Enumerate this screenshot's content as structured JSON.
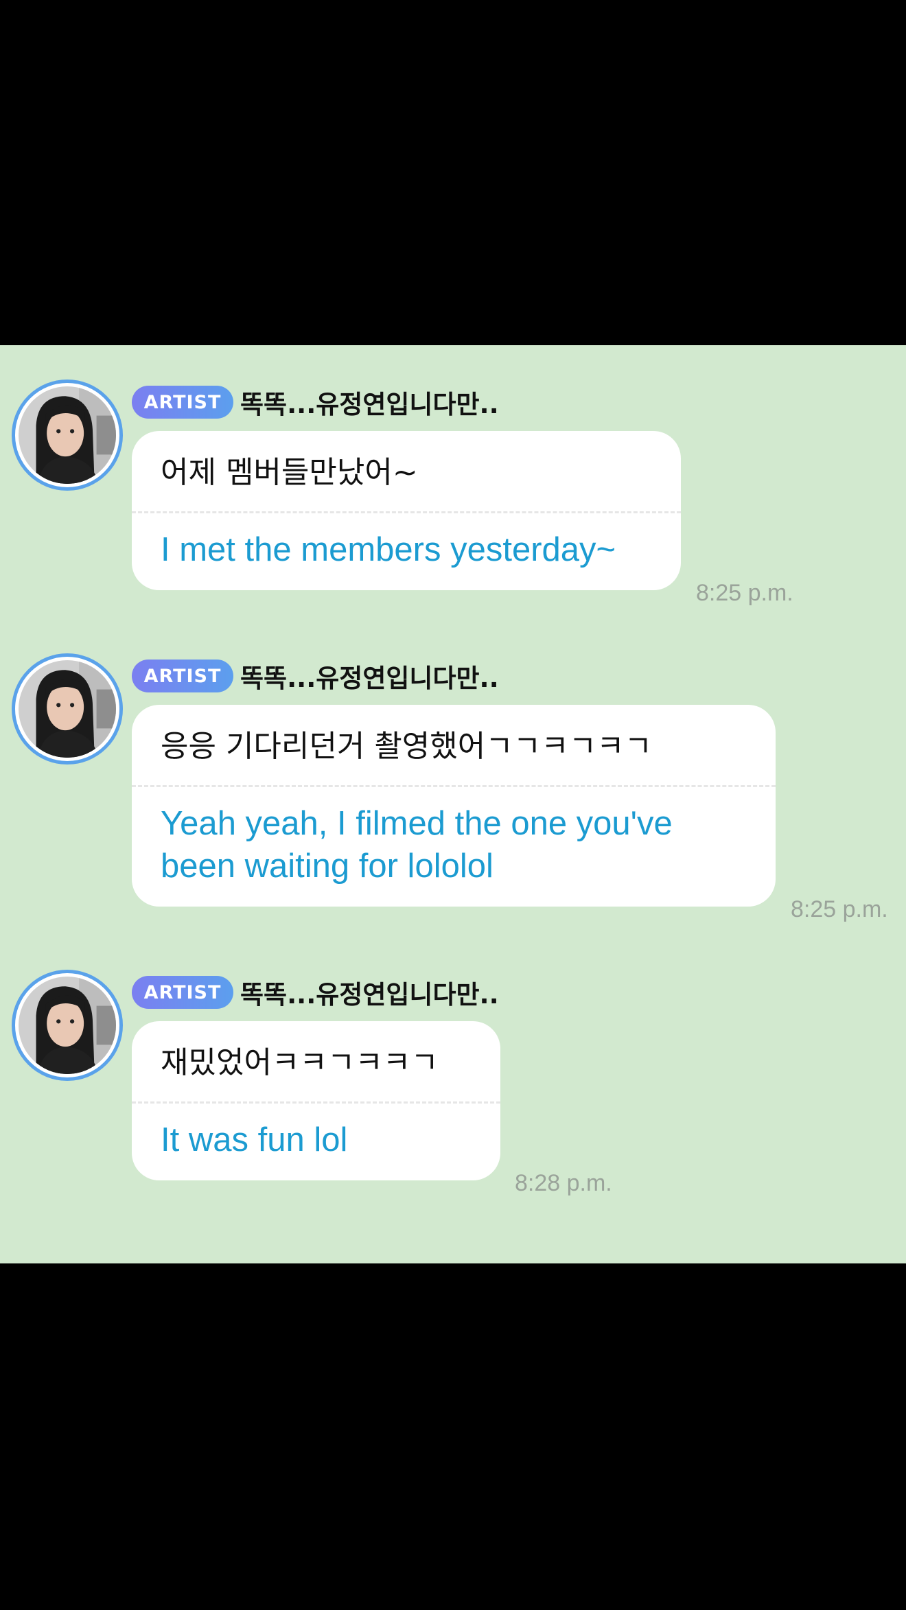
{
  "colors": {
    "chat_background": "#d2e9cf",
    "bubble_background": "#ffffff",
    "translation_text": "#1b9bd1",
    "badge_gradient_start": "#7b7ff0",
    "badge_gradient_end": "#5c9fee",
    "avatar_ring": "#5aa2ea",
    "timestamp": "#9aa39a"
  },
  "messages": [
    {
      "badge": "ARTIST",
      "sender": "똑똑...유정연입니다만..",
      "avatar_icon": "profile-photo",
      "original": "어제 멤버들만났어~",
      "translation": "I met the members yesterday~",
      "time": "8:25 p.m."
    },
    {
      "badge": "ARTIST",
      "sender": "똑똑...유정연입니다만..",
      "avatar_icon": "profile-photo",
      "original": "응응 기다리던거 촬영했어ㄱㄱㅋㄱㅋㄱ",
      "translation": "Yeah yeah, I filmed the one you've been waiting for lololol",
      "time": "8:25 p.m."
    },
    {
      "badge": "ARTIST",
      "sender": "똑똑...유정연입니다만..",
      "avatar_icon": "profile-photo",
      "original": "재밌었어ㅋㅋㄱㅋㅋㄱ",
      "translation": "It was fun lol",
      "time": "8:28 p.m."
    }
  ]
}
